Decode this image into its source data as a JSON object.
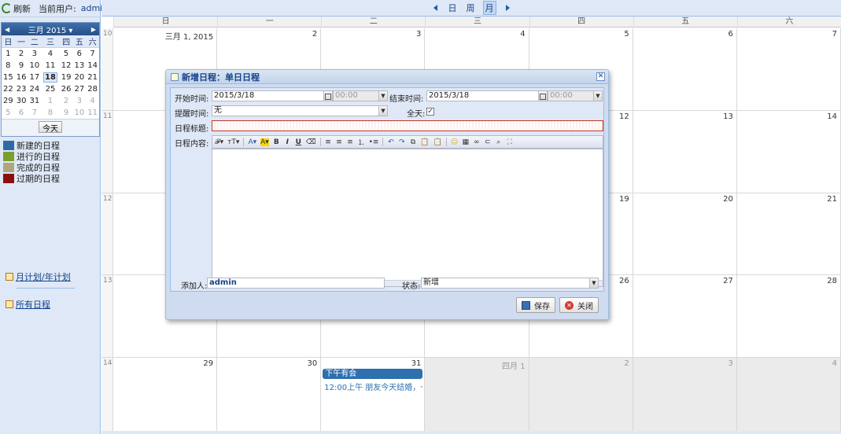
{
  "topbar": {
    "refresh_label": "刷新",
    "user_label": "当前用户:",
    "user_name": "admin"
  },
  "mini_calendar": {
    "title": "三月 2015",
    "weekdays": [
      "日",
      "一",
      "二",
      "三",
      "四",
      "五",
      "六"
    ],
    "rows": [
      [
        "1",
        "2",
        "3",
        "4",
        "5",
        "6",
        "7"
      ],
      [
        "8",
        "9",
        "10",
        "11",
        "12",
        "13",
        "14"
      ],
      [
        "15",
        "16",
        "17",
        "18",
        "19",
        "20",
        "21"
      ],
      [
        "22",
        "23",
        "24",
        "25",
        "26",
        "27",
        "28"
      ],
      [
        "29",
        "30",
        "31",
        "1",
        "2",
        "3",
        "4"
      ],
      [
        "5",
        "6",
        "7",
        "8",
        "9",
        "10",
        "11"
      ]
    ],
    "today_label": "今天"
  },
  "legend": [
    {
      "label": "新建的日程",
      "color": "#2e6aa8"
    },
    {
      "label": "进行的日程",
      "color": "#7a9f2c"
    },
    {
      "label": "完成的日程",
      "color": "#b0a67e"
    },
    {
      "label": "过期的日程",
      "color": "#8a1010"
    }
  ],
  "side_links": {
    "plan": "月计划/年计划",
    "all": "所有日程"
  },
  "nav": {
    "day": "日",
    "week": "周",
    "month": "月"
  },
  "calendar": {
    "weekdays": [
      "日",
      "一",
      "二",
      "三",
      "四",
      "五",
      "六"
    ],
    "weeks": [
      {
        "num": "10",
        "days": [
          "三月 1, 2015",
          "2",
          "3",
          "4",
          "5",
          "6",
          "7"
        ]
      },
      {
        "num": "11",
        "days": [
          "",
          "",
          "",
          "",
          "12",
          "13",
          "14"
        ]
      },
      {
        "num": "12",
        "days": [
          "",
          "",
          "",
          "",
          "19",
          "20",
          "21"
        ]
      },
      {
        "num": "13",
        "days": [
          "",
          "",
          "",
          "",
          "26",
          "27",
          "28"
        ]
      },
      {
        "num": "14",
        "days": [
          "29",
          "30",
          "31",
          "四月 1",
          "2",
          "3",
          "4"
        ]
      }
    ],
    "event_title": "下午有会",
    "event_line": "12:00上午 朋友今天结婚，一..."
  },
  "dialog": {
    "title": "新增日程：单日日程",
    "start_label": "开始时间:",
    "start_date": "2015/3/18",
    "start_time": "00:00",
    "end_label": "结束时间:",
    "end_date": "2015/3/18",
    "end_time": "00:00",
    "remind_label": "提醒时间:",
    "remind_value": "无",
    "allday_label": "全天:",
    "allday_checked": "✓",
    "subject_label": "日程标题:",
    "content_label": "日程内容:",
    "adder_label": "添加人:",
    "adder_value": "admin",
    "status_label": "状态:",
    "status_value": "新增",
    "save_label": "保存",
    "close_label": "关闭"
  }
}
